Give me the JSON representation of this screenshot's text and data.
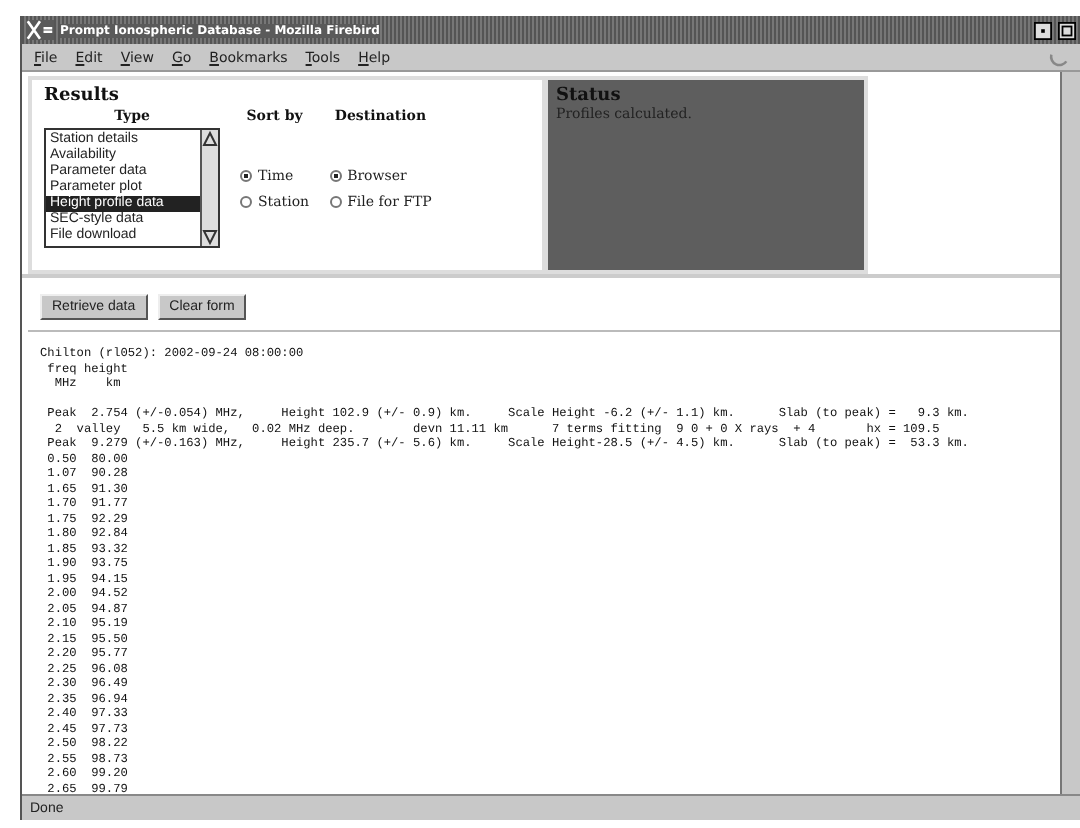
{
  "window": {
    "title": "Prompt Ionospheric Database - Mozilla Firebird"
  },
  "menu": [
    "File",
    "Edit",
    "View",
    "Go",
    "Bookmarks",
    "Tools",
    "Help"
  ],
  "results": {
    "title": "Results",
    "type_heading": "Type",
    "sort_heading": "Sort by",
    "dest_heading": "Destination",
    "types": [
      {
        "label": "Station details",
        "selected": false
      },
      {
        "label": "Availability",
        "selected": false
      },
      {
        "label": "Parameter data",
        "selected": false
      },
      {
        "label": "Parameter plot",
        "selected": false
      },
      {
        "label": "Height profile data",
        "selected": true
      },
      {
        "label": "SEC-style data",
        "selected": false
      },
      {
        "label": "File download",
        "selected": false
      }
    ],
    "sort_by": [
      {
        "label": "Time",
        "selected": true
      },
      {
        "label": "Station",
        "selected": false
      }
    ],
    "destination": [
      {
        "label": "Browser",
        "selected": true
      },
      {
        "label": "File for FTP",
        "selected": false
      }
    ]
  },
  "status": {
    "title": "Status",
    "message": "Profiles calculated."
  },
  "buttons": [
    "Retrieve data",
    "Clear form"
  ],
  "output": {
    "header": [
      "Chilton (rl052): 2002-09-24 08:00:00",
      " freq height",
      "  MHz    km"
    ],
    "fit_lines": [
      " Peak  2.754 (+/-0.054) MHz,     Height 102.9 (+/- 0.9) km.     Scale Height -6.2 (+/- 1.1) km.      Slab (to peak) =   9.3 km.",
      "  2  valley   5.5 km wide,   0.02 MHz deep.        devn 11.11 km      7 terms fitting  9 0 + 0 X rays  + 4       hx = 109.5",
      " Peak  9.279 (+/-0.163) MHz,     Height 235.7 (+/- 5.6) km.     Scale Height-28.5 (+/- 4.5) km.      Slab (to peak) =  53.3 km."
    ],
    "rows": [
      [
        "0.50",
        "80.00"
      ],
      [
        "1.07",
        "90.28"
      ],
      [
        "1.65",
        "91.30"
      ],
      [
        "1.70",
        "91.77"
      ],
      [
        "1.75",
        "92.29"
      ],
      [
        "1.80",
        "92.84"
      ],
      [
        "1.85",
        "93.32"
      ],
      [
        "1.90",
        "93.75"
      ],
      [
        "1.95",
        "94.15"
      ],
      [
        "2.00",
        "94.52"
      ],
      [
        "2.05",
        "94.87"
      ],
      [
        "2.10",
        "95.19"
      ],
      [
        "2.15",
        "95.50"
      ],
      [
        "2.20",
        "95.77"
      ],
      [
        "2.25",
        "96.08"
      ],
      [
        "2.30",
        "96.49"
      ],
      [
        "2.35",
        "96.94"
      ],
      [
        "2.40",
        "97.33"
      ],
      [
        "2.45",
        "97.73"
      ],
      [
        "2.50",
        "98.22"
      ],
      [
        "2.55",
        "98.73"
      ],
      [
        "2.60",
        "99.20"
      ],
      [
        "2.65",
        "99.79"
      ]
    ]
  },
  "status_bar": "Done"
}
